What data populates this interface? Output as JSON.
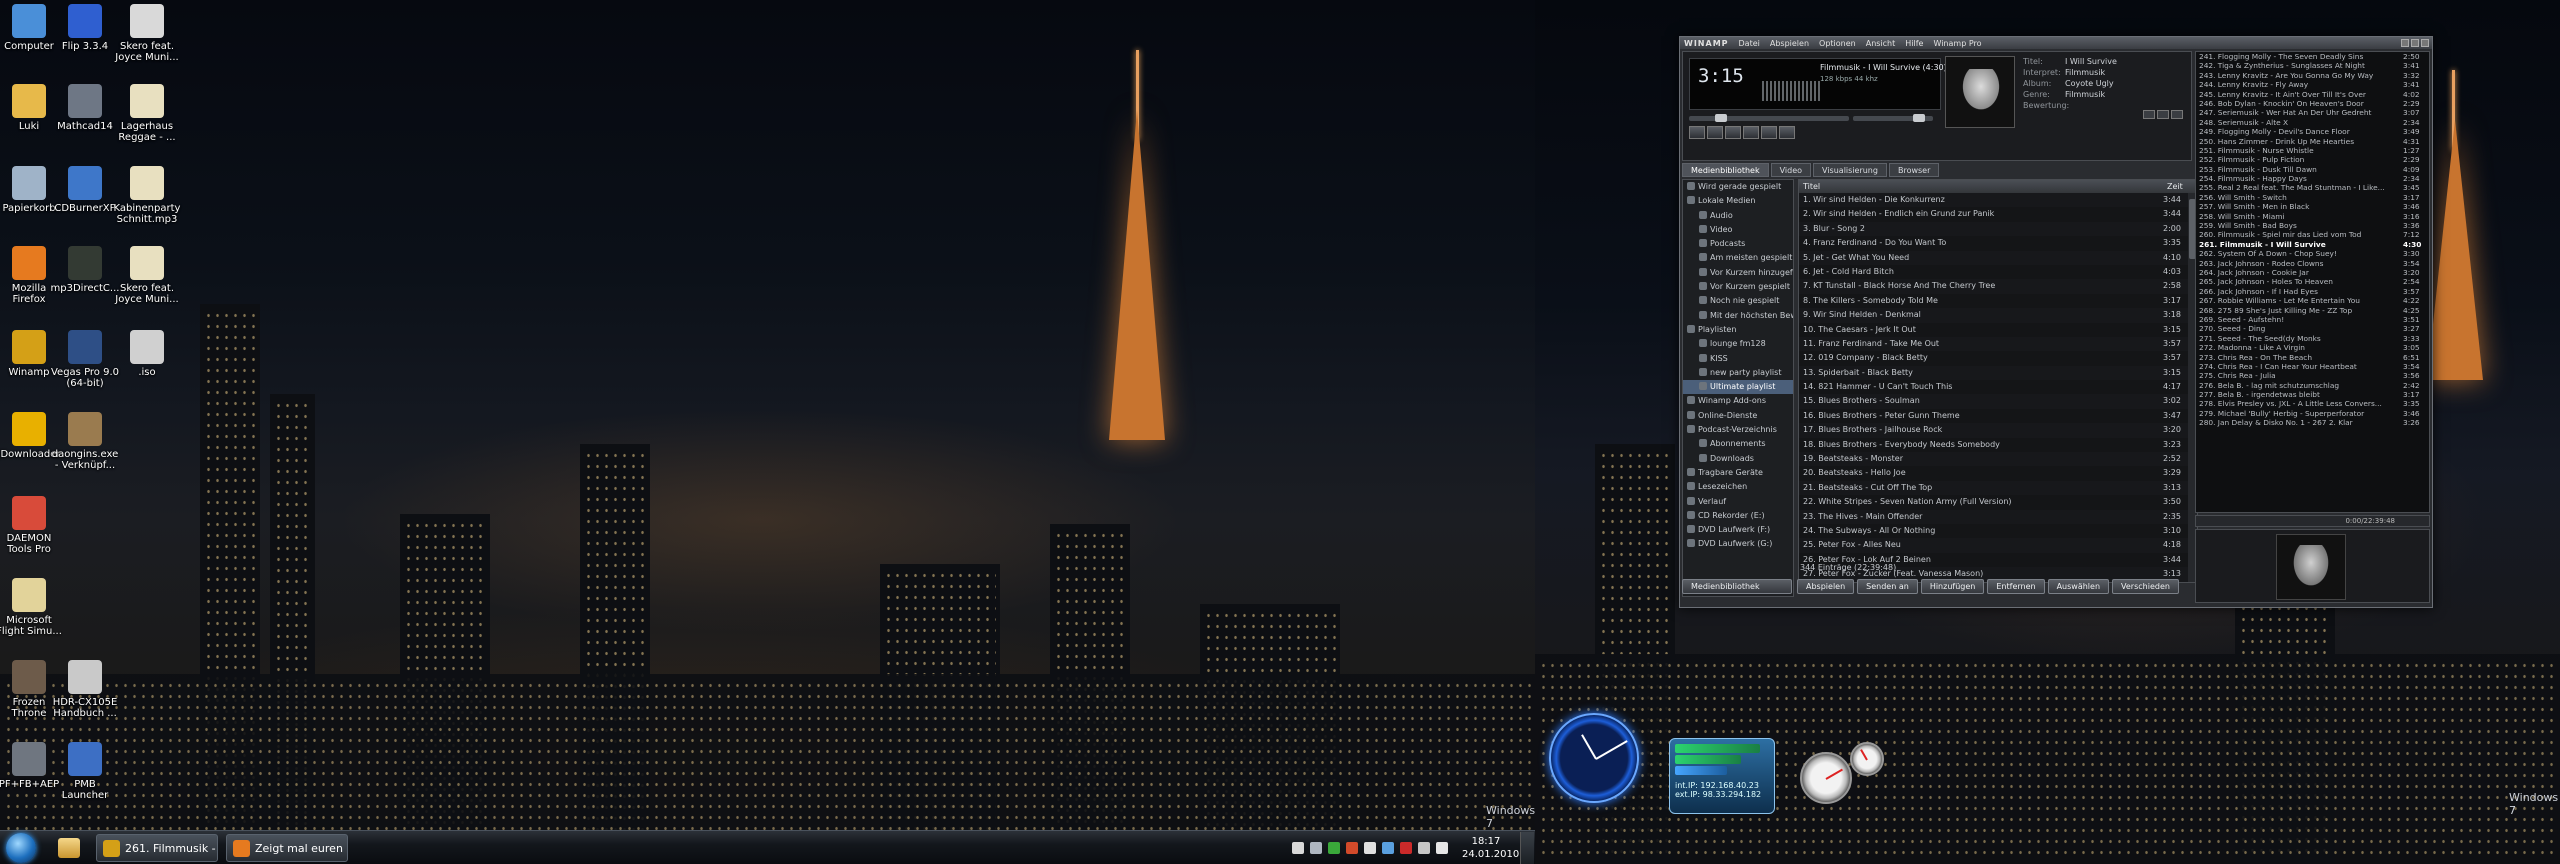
{
  "desktop": {
    "watermark": "Windows 7",
    "icons": [
      {
        "label": "Computer",
        "color": "#4a8fd8"
      },
      {
        "label": "Flip 3.3.4",
        "color": "#2f5fd0"
      },
      {
        "label": "Skero feat. Joyce Muni...",
        "color": "#d9d9d9"
      },
      {
        "label": "Luki",
        "color": "#e7b94a"
      },
      {
        "label": "Mathcad14",
        "color": "#6e7785"
      },
      {
        "label": "Lagerhaus Reggae - ...",
        "color": "#e8e0c0"
      },
      {
        "label": "Papierkorb",
        "color": "#9fb3c8"
      },
      {
        "label": "CDBurnerXP",
        "color": "#3e77c9"
      },
      {
        "label": "Kabinenparty Schnitt.mp3",
        "color": "#e8e0c0"
      },
      {
        "label": "Mozilla Firefox",
        "color": "#e67a1f"
      },
      {
        "label": "mp3DirectC...",
        "color": "#333a33"
      },
      {
        "label": "Skero feat. Joyce Muni...",
        "color": "#e8e0c0"
      },
      {
        "label": "Winamp",
        "color": "#d4a017"
      },
      {
        "label": "Vegas Pro 9.0 (64-bit)",
        "color": "#2e4f86"
      },
      {
        "label": ".iso",
        "color": "#d0d0d0"
      },
      {
        "label": "JDownloader",
        "color": "#e8b000"
      },
      {
        "label": "daongins.exe - Verknüpf...",
        "color": "#9a7b4f"
      },
      {
        "label": "DAEMON Tools Pro",
        "color": "#d84b3a"
      },
      {
        "label": "Microsoft Flight Simu...",
        "color": "#e2d39a"
      },
      {
        "label": "Frozen Throne",
        "color": "#6d5b4a"
      },
      {
        "label": "HDR-CX105E Handbuch ...",
        "color": "#c9c9c9"
      },
      {
        "label": "PF+FB+AEP",
        "color": "#6f7680"
      },
      {
        "label": "PMB Launcher",
        "color": "#3d6fc4"
      }
    ]
  },
  "taskbar": {
    "buttons": [
      {
        "label": "261. Filmmusik - I...",
        "color": "#d4a017"
      },
      {
        "label": "Zeigt mal euren D...",
        "color": "#e67a1f"
      }
    ],
    "clock_time": "18:17",
    "clock_date": "24.01.2010"
  },
  "gadgets": {
    "net_ip1": "int.IP: 192.168.40.23",
    "net_ip2": "ext.IP: 98.33.294.182"
  },
  "winamp": {
    "title": "WINAMP",
    "menu": [
      "Datei",
      "Abspielen",
      "Optionen",
      "Ansicht",
      "Hilfe",
      "Winamp Pro"
    ],
    "time": "3:15",
    "now_playing": "Filmmusik - I Will Survive (4:30)",
    "kbps": "128 kbps  44 khz",
    "meta": [
      {
        "key": "Titel:",
        "value": "I Will Survive"
      },
      {
        "key": "Interpret:",
        "value": "Filmmusik"
      },
      {
        "key": "Album:",
        "value": "Coyote Ugly"
      },
      {
        "key": "Genre:",
        "value": "Filmmusik"
      },
      {
        "key": "Bewertung:",
        "value": ""
      }
    ],
    "tabs": [
      "Medienbibliothek",
      "Video",
      "Visualisierung",
      "Browser"
    ],
    "tree": [
      "Wird gerade gespielt",
      "Lokale Medien",
      "Audio",
      "Video",
      "Podcasts",
      "Am meisten gespielt",
      "Vor Kurzem hinzugefügt",
      "Vor Kurzem gespielt",
      "Noch nie gespielt",
      "Mit der höchsten Bew.",
      "Playlisten",
      "lounge fm128",
      "KISS",
      "new party playlist",
      "Ultimate playlist",
      "Winamp Add-ons",
      "Online-Dienste",
      "Podcast-Verzeichnis",
      "Abonnements",
      "Downloads",
      "Tragbare Geräte",
      "Lesezeichen",
      "Verlauf",
      "CD Rekorder (E:)",
      "DVD Laufwerk (F:)",
      "DVD Laufwerk (G:)"
    ],
    "tree_selected": 14,
    "list_header": {
      "title": "Titel",
      "length": "Zeit"
    },
    "tracks": [
      {
        "t": "1. Wir sind Helden - Die Konkurrenz",
        "d": "3:44"
      },
      {
        "t": "2. Wir sind Helden - Endlich ein Grund zur Panik",
        "d": "3:44"
      },
      {
        "t": "3. Blur - Song 2",
        "d": "2:00"
      },
      {
        "t": "4. Franz Ferdinand - Do You Want To",
        "d": "3:35"
      },
      {
        "t": "5. Jet - Get What You Need",
        "d": "4:10"
      },
      {
        "t": "6. Jet - Cold Hard Bitch",
        "d": "4:03"
      },
      {
        "t": "7. KT Tunstall - Black Horse And The Cherry Tree",
        "d": "2:58"
      },
      {
        "t": "8. The Killers - Somebody Told Me",
        "d": "3:17"
      },
      {
        "t": "9. Wir Sind Helden - Denkmal",
        "d": "3:18"
      },
      {
        "t": "10. The Caesars - Jerk It Out",
        "d": "3:15"
      },
      {
        "t": "11. Franz Ferdinand - Take Me Out",
        "d": "3:57"
      },
      {
        "t": "12. 019 Company - Black Betty",
        "d": "3:57"
      },
      {
        "t": "13. Spiderbait - Black Betty",
        "d": "3:15"
      },
      {
        "t": "14. 821 Hammer - U Can't Touch This",
        "d": "4:17"
      },
      {
        "t": "15. Blues Brothers - Soulman",
        "d": "3:02"
      },
      {
        "t": "16. Blues Brothers - Peter Gunn Theme",
        "d": "3:47"
      },
      {
        "t": "17. Blues Brothers - Jailhouse Rock",
        "d": "3:20"
      },
      {
        "t": "18. Blues Brothers - Everybody Needs Somebody",
        "d": "3:23"
      },
      {
        "t": "19. Beatsteaks - Monster",
        "d": "2:52"
      },
      {
        "t": "20. Beatsteaks - Hello Joe",
        "d": "3:29"
      },
      {
        "t": "21. Beatsteaks - Cut Off The Top",
        "d": "3:13"
      },
      {
        "t": "22. White Stripes - Seven Nation Army (Full Version)",
        "d": "3:50"
      },
      {
        "t": "23. The Hives - Main Offender",
        "d": "2:35"
      },
      {
        "t": "24. The Subways - All Or Nothing",
        "d": "3:10"
      },
      {
        "t": "25. Peter Fox - Alles Neu",
        "d": "4:18"
      },
      {
        "t": "26. Peter Fox - Lok Auf 2 Beinen",
        "d": "3:44"
      },
      {
        "t": "27. Peter Fox - Zucker (Feat. Vanessa Mason)",
        "d": "3:13"
      }
    ],
    "status": "344 Einträge (22:39:48)",
    "bottom_buttons": [
      "Medienbibliothek",
      "Abspielen",
      "Senden an",
      "Hinzufügen",
      "Entfernen",
      "Auswählen",
      "Verschieden"
    ],
    "playlist_time": "0:00/22:39:48",
    "playlist": [
      {
        "t": "241. Flogging Molly - The Seven Deadly Sins",
        "d": "2:50"
      },
      {
        "t": "242. Tiga & Zyntherius - Sunglasses At Night",
        "d": "3:41"
      },
      {
        "t": "243. Lenny Kravitz - Are You Gonna Go My Way",
        "d": "3:32"
      },
      {
        "t": "244. Lenny Kravitz - Fly Away",
        "d": "3:41"
      },
      {
        "t": "245. Lenny Kravitz - It Ain't Over Till It's Over",
        "d": "4:02"
      },
      {
        "t": "246. Bob Dylan - Knockin' On Heaven's Door",
        "d": "2:29"
      },
      {
        "t": "247. Seriemusik - Wer Hat An Der Uhr Gedreht",
        "d": "3:07"
      },
      {
        "t": "248. Seriemusik - Alte X",
        "d": "2:34"
      },
      {
        "t": "249. Flogging Molly - Devil's Dance Floor",
        "d": "3:49"
      },
      {
        "t": "250. Hans Zimmer - Drink Up Me Hearties",
        "d": "4:31"
      },
      {
        "t": "251. Filmmusik - Nurse Whistle",
        "d": "1:27"
      },
      {
        "t": "252. Filmmusik - Pulp Fiction",
        "d": "2:29"
      },
      {
        "t": "253. Filmmusik - Dusk Till Dawn",
        "d": "4:09"
      },
      {
        "t": "254. Filmmusik - Happy Days",
        "d": "2:34"
      },
      {
        "t": "255. Real 2 Real feat. The Mad Stuntman - I Like...",
        "d": "3:45"
      },
      {
        "t": "256. Will Smith - Switch",
        "d": "3:17"
      },
      {
        "t": "257. Will Smith - Men in Black",
        "d": "3:46"
      },
      {
        "t": "258. Will Smith - Miami",
        "d": "3:16"
      },
      {
        "t": "259. Will Smith - Bad Boys",
        "d": "3:36"
      },
      {
        "t": "260. Filmmusik - Spiel mir das Lied vom Tod",
        "d": "7:12"
      },
      {
        "t": "261. Filmmusik - I Will Survive",
        "d": "4:30"
      },
      {
        "t": "262. System Of A Down - Chop Suey!",
        "d": "3:30"
      },
      {
        "t": "263. Jack Johnson - Rodeo Clowns",
        "d": "3:54"
      },
      {
        "t": "264. Jack Johnson - Cookie Jar",
        "d": "3:20"
      },
      {
        "t": "265. Jack Johnson - Holes To Heaven",
        "d": "2:54"
      },
      {
        "t": "266. Jack Johnson - If I Had Eyes",
        "d": "3:57"
      },
      {
        "t": "267. Robbie Williams - Let Me Entertain You",
        "d": "4:22"
      },
      {
        "t": "268. 275 89 She's Just Killing Me - ZZ Top",
        "d": "4:25"
      },
      {
        "t": "269. Seeed - Aufstehn!",
        "d": "3:51"
      },
      {
        "t": "270. Seeed - Ding",
        "d": "3:27"
      },
      {
        "t": "271. Seeed - The Seed(dy Monks",
        "d": "3:33"
      },
      {
        "t": "272. Madonna - Like A Virgin",
        "d": "3:05"
      },
      {
        "t": "273. Chris Rea - On The Beach",
        "d": "6:51"
      },
      {
        "t": "274. Chris Rea - I Can Hear Your Heartbeat",
        "d": "3:54"
      },
      {
        "t": "275. Chris Rea - Julia",
        "d": "3:56"
      },
      {
        "t": "276. Bela B. - lag mit schutzumschlag",
        "d": "2:42"
      },
      {
        "t": "277. Bela B. - irgendetwas bleibt",
        "d": "3:17"
      },
      {
        "t": "278. Elvis Presley vs. JXL - A Little Less Convers...",
        "d": "3:35"
      },
      {
        "t": "279. Michael 'Bully' Herbig - Superperforator",
        "d": "3:46"
      },
      {
        "t": "280. Jan Delay & Disko No. 1 - 267 2. Klar",
        "d": "3:26"
      }
    ],
    "playlist_current": 20
  }
}
